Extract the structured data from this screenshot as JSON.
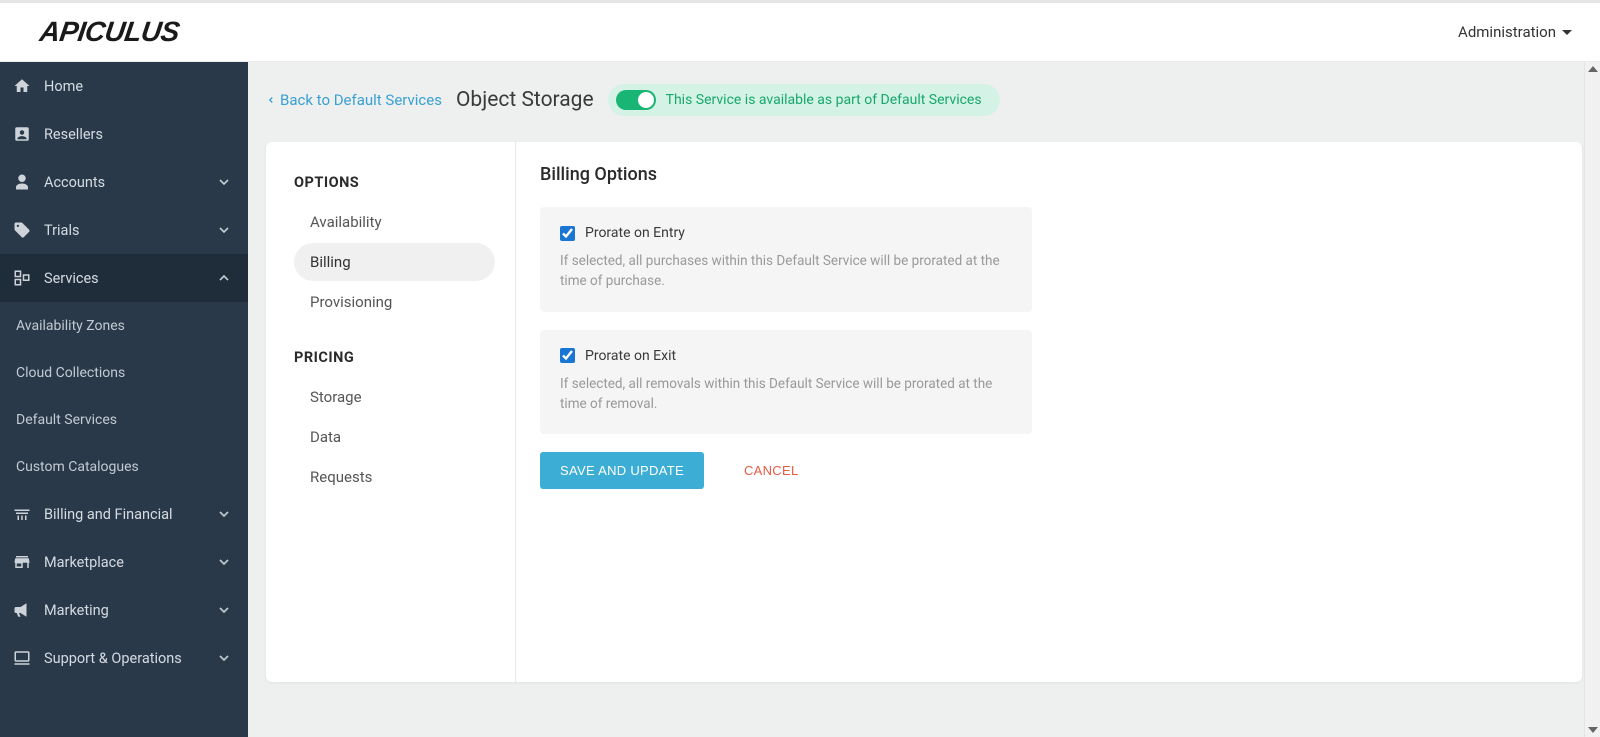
{
  "header": {
    "brand": "APICULUS",
    "admin_label": "Administration"
  },
  "sidebar": {
    "items": [
      {
        "label": "Home",
        "icon": "home",
        "expandable": false
      },
      {
        "label": "Resellers",
        "icon": "resellers",
        "expandable": false
      },
      {
        "label": "Accounts",
        "icon": "accounts",
        "expandable": true,
        "expanded": false
      },
      {
        "label": "Trials",
        "icon": "trials",
        "expandable": true,
        "expanded": false
      },
      {
        "label": "Services",
        "icon": "services",
        "expandable": true,
        "expanded": true
      },
      {
        "label": "Billing and Financial",
        "icon": "billing",
        "expandable": true,
        "expanded": false
      },
      {
        "label": "Marketplace",
        "icon": "marketplace",
        "expandable": true,
        "expanded": false
      },
      {
        "label": "Marketing",
        "icon": "marketing",
        "expandable": true,
        "expanded": false
      },
      {
        "label": "Support & Operations",
        "icon": "support",
        "expandable": true,
        "expanded": false
      }
    ],
    "services_sub": [
      {
        "label": "Availability Zones"
      },
      {
        "label": "Cloud Collections"
      },
      {
        "label": "Default Services"
      },
      {
        "label": "Custom Catalogues"
      }
    ]
  },
  "page": {
    "back_label": "Back to Default Services",
    "title": "Object Storage",
    "toggle_text": "This Service is available as part of Default Services",
    "toggle_on": true
  },
  "options_panel": {
    "options_head": "OPTIONS",
    "options": [
      {
        "label": "Availability",
        "active": false
      },
      {
        "label": "Billing",
        "active": true
      },
      {
        "label": "Provisioning",
        "active": false
      }
    ],
    "pricing_head": "PRICING",
    "pricing": [
      {
        "label": "Storage"
      },
      {
        "label": "Data"
      },
      {
        "label": "Requests"
      }
    ]
  },
  "billing": {
    "heading": "Billing Options",
    "entry": {
      "label": "Prorate on Entry",
      "desc": "If selected, all purchases within this Default Service will be prorated at the time of purchase.",
      "checked": true
    },
    "exit": {
      "label": "Prorate on Exit",
      "desc": "If selected, all removals within this Default Service will be prorated at the time of removal.",
      "checked": true
    },
    "save_label": "SAVE AND UPDATE",
    "cancel_label": "CANCEL"
  }
}
